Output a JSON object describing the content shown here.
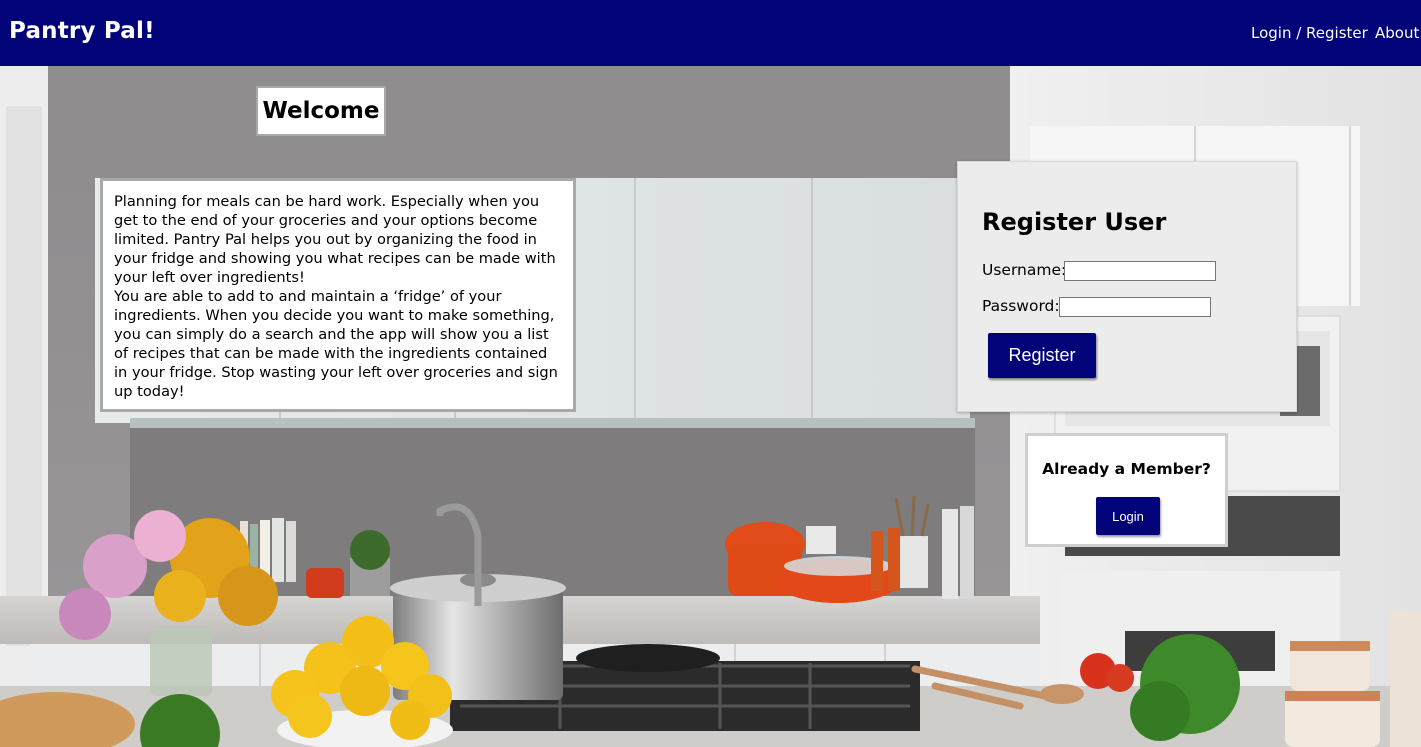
{
  "nav": {
    "brand": "Pantry Pal!",
    "links": [
      "Login / Register",
      "About"
    ]
  },
  "welcome": {
    "title": "Welcome"
  },
  "intro": {
    "paragraph1": "Planning for meals can be hard work. Especially when you get to the end of your groceries and your options become limited. Pantry Pal helps you out by organizing the food in your fridge and showing you what recipes can be made with your left over ingredients!",
    "paragraph2": "You are able to add to and maintain a ‘fridge’ of your ingredients. When you decide you want to make something, you can simply do a search and the app will show you a list of recipes that can be made with the ingredients contained in your fridge. Stop wasting your left over groceries and sign up today!"
  },
  "register": {
    "title": "Register User",
    "username_label": "Username:",
    "password_label": "Password:",
    "username_value": "",
    "password_value": "",
    "button": "Register"
  },
  "member": {
    "title": "Already a Member?",
    "button": "Login"
  },
  "colors": {
    "brand": "#020279",
    "panel": "#ececec"
  }
}
